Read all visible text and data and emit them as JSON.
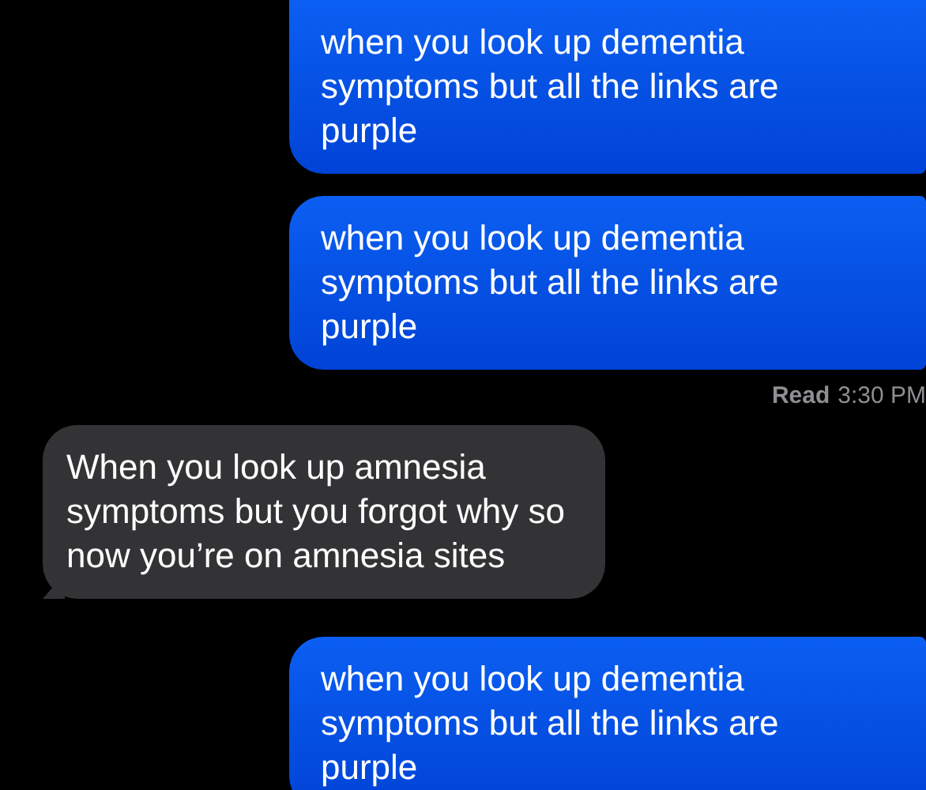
{
  "messages": [
    {
      "kind": "sent",
      "text": "when you look up dementia symptoms but all the links are purple"
    },
    {
      "kind": "sent",
      "text": "when you look up dementia symptoms but all the links are purple"
    },
    {
      "kind": "receipt",
      "status": "Read",
      "time": "3:30 PM"
    },
    {
      "kind": "received",
      "text": "When you look up amnesia symptoms but you forgot why so now you’re on amnesia sites"
    },
    {
      "kind": "sent",
      "text": "when you look up dementia symptoms but all the links are purple"
    }
  ]
}
